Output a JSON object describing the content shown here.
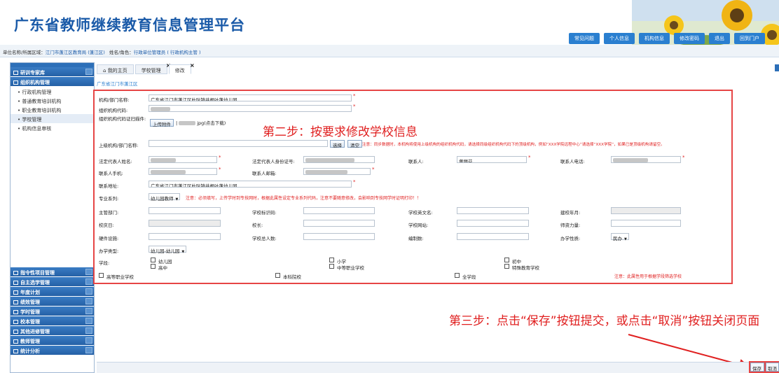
{
  "header": {
    "title": "广东省教师继续教育信息管理平台",
    "nav": [
      "常见问题",
      "个人信息",
      "机构信息",
      "修改密码",
      "退出",
      "回到门户"
    ]
  },
  "userbar": {
    "region_label": "单位名称/所属区域：",
    "region_value": "江门市蓬江区教育局 (蓬江区)",
    "name_label": "姓名/角色：",
    "name_value": "行政单位管理员 ( 行政机构主管 )"
  },
  "sidebar": {
    "group_yanxun": "研训专家库",
    "group_zuzhi": "组织机构管理",
    "items": [
      "行政机构管理",
      "普通教育培训机构",
      "职业教育培训机构",
      "学校管理",
      "机构信息审核"
    ],
    "lower_groups": [
      "指令性项目管理",
      "自主选学管理",
      "年度计划",
      "绩效管理",
      "学时管理",
      "校本管理",
      "其他进修管理",
      "教师管理",
      "统计分析"
    ]
  },
  "tabs": [
    "我的主页",
    "学校管理",
    "修改"
  ],
  "breadcrumb": "广东省江门市蓬江区",
  "form": {
    "name_label": "机构/部门名称:",
    "name_value": "广东省江门市蓬江区杜阮镇井根叶蓬幼儿园",
    "code_label": "组织机构代码:",
    "scan_label": "组织机构代码证扫描件:",
    "upload_button": "上传附件",
    "file_text": "jpg(点击下载)",
    "parent_label": "上级机构/部门名称:",
    "choose_button": "选择",
    "clear_button": "清空",
    "parent_note": "注意：同步数据时，本机构将使用上级机构的组织机构代码，请选择同级组织机构代码下的顶级机构，例如“XXX学院远程中心”请选择“XXX学院”，如果已是顶级机构请留空。",
    "legal_name_label": "法定代表人姓名:",
    "legal_id_label": "法定代表人身份证号:",
    "contact_label": "联系人:",
    "contact_value": "黄丽芬",
    "contact_phone_label": "联系人电话:",
    "legal_mobile_label": "联系人手机:",
    "contact_email_label": "联系人邮箱:",
    "address_label": "联系地址:",
    "address_value": "广东省江门市蓬江区杜阮镇井根叶蓬幼儿园",
    "series_label": "专业系列:",
    "series_value": "幼儿园教师",
    "series_note": "注意：必须填写，上传学时到专技网时，根据此属性设定专业系列代码，注意不要随意修改，会影响到专技网学时证明打印！！",
    "dept_label": "主管部门:",
    "school_id_label": "学校标识码:",
    "school_en_label": "学校英文名:",
    "founded_label": "建校年月:",
    "anniv_label": "校庆日:",
    "principal_label": "校长:",
    "website_label": "学校网站:",
    "teachers_label": "师资力量:",
    "hardware_label": "硬件设施:",
    "students_label": "学校总人数:",
    "staffing_label": "编制数:",
    "nature_label": "办学性质:",
    "nature_value": "民办",
    "type_label": "办学类型:",
    "type_value": "幼儿园-幼儿园",
    "stage_label": "学段:",
    "stages": [
      "幼儿园",
      "高中",
      "小学",
      "中等职业学校",
      "初中",
      "特殊教育学校",
      "高等职业学校",
      "本科院校",
      "全学段"
    ],
    "stage_note": "注意：此属性用于根据学段筛选学校"
  },
  "annotations": {
    "step2": "第二步：按要求修改学校信息",
    "step3": "第三步：点击“保存”按钮提交，或点击“取消”按钮关闭页面"
  },
  "footer": {
    "save": "保存",
    "cancel": "取消"
  },
  "colors": {
    "brand": "#1a5aa8",
    "sidebar": "#2561a6",
    "annotation": "#e02020",
    "nav_button": "#2a7fd0"
  }
}
